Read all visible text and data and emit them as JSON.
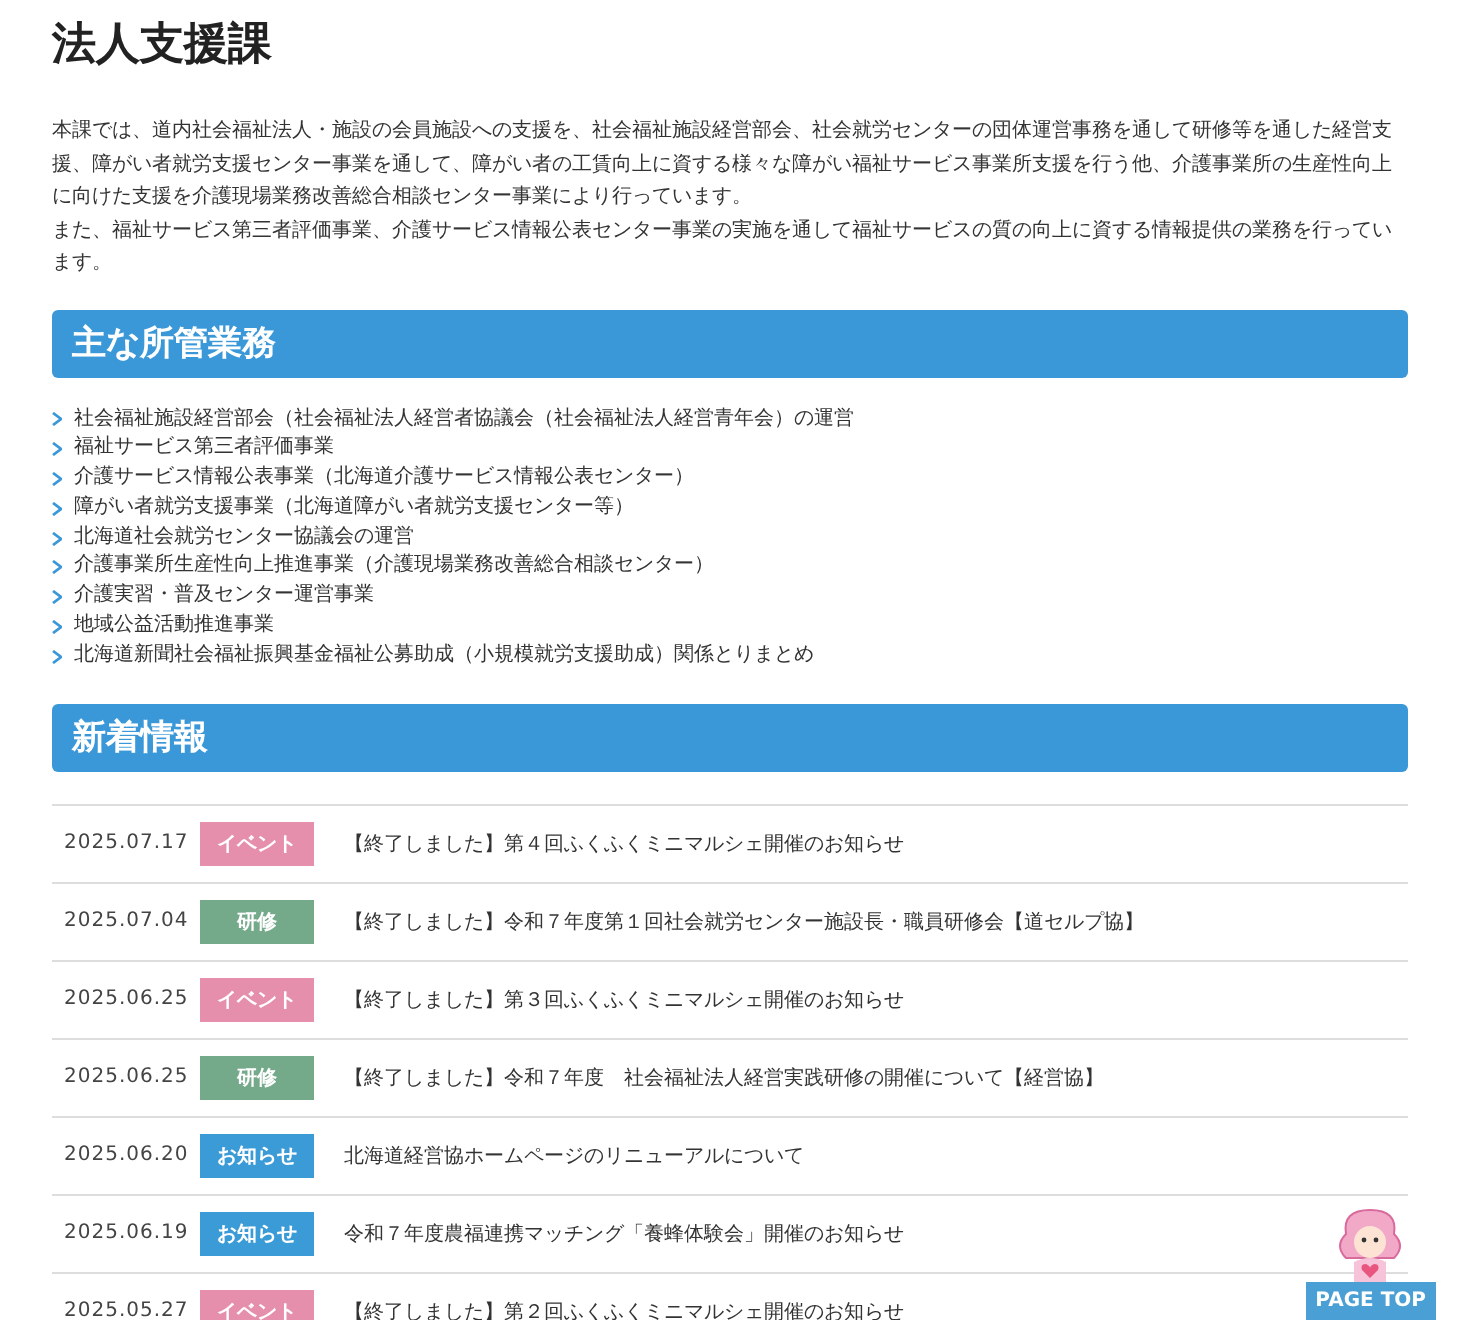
{
  "title": "法人支援課",
  "intro": [
    "本課では、道内社会福祉法人・施設の会員施設への支援を、社会福祉施設経営部会、社会就労センターの団体運営事務を通して研修等を通した経営支援、障がい者就労支援センター事業を通して、障がい者の工賃向上に資する様々な障がい福祉サービス事業所支援を行う他、介護事業所の生産性向上に向けた支援を介護現場業務改善総合相談センター事業により行っています。",
    "また、福祉サービス第三者評価事業、介護サービス情報公表センター事業の実施を通して福祉サービスの質の向上に資する情報提供の業務を行っています。"
  ],
  "duties": {
    "heading": "主な所管業務",
    "items": [
      "社会福祉施設経営部会（社会福祉法人経営者協議会（社会福祉法人経営青年会）の運営",
      "福祉サービス第三者評価事業",
      "介護サービス情報公表事業（北海道介護サービス情報公表センター）",
      "障がい者就労支援事業（北海道障がい者就労支援センター等）",
      "北海道社会就労センター協議会の運営",
      "介護事業所生産性向上推進事業（介護現場業務改善総合相談センター）",
      "介護実習・普及センター運営事業",
      "地域公益活動推進事業",
      "北海道新聞社会福祉振興基金福祉公募助成（小規模就労支援助成）関係とりまとめ"
    ]
  },
  "news": {
    "heading": "新着情報",
    "rows": [
      {
        "date": "2025.07.17",
        "kind": "event",
        "badge": "イベント",
        "title": "【終了しました】第４回ふくふくミニマルシェ開催のお知らせ"
      },
      {
        "date": "2025.07.04",
        "kind": "training",
        "badge": "研修",
        "title": "【終了しました】令和７年度第１回社会就労センター施設長・職員研修会【道セルプ協】"
      },
      {
        "date": "2025.06.25",
        "kind": "event",
        "badge": "イベント",
        "title": "【終了しました】第３回ふくふくミニマルシェ開催のお知らせ"
      },
      {
        "date": "2025.06.25",
        "kind": "training",
        "badge": "研修",
        "title": "【終了しました】令和７年度　社会福祉法人経営実践研修の開催について【経営協】"
      },
      {
        "date": "2025.06.20",
        "kind": "notice",
        "badge": "お知らせ",
        "title": "北海道経営協ホームページのリニューアルについて"
      },
      {
        "date": "2025.06.19",
        "kind": "notice",
        "badge": "お知らせ",
        "title": "令和７年度農福連携マッチング「養蜂体験会」開催のお知らせ"
      },
      {
        "date": "2025.05.27",
        "kind": "event",
        "badge": "イベント",
        "title": "【終了しました】第２回ふくふくミニマルシェ開催のお知らせ"
      }
    ]
  },
  "page_top": "PAGE TOP"
}
